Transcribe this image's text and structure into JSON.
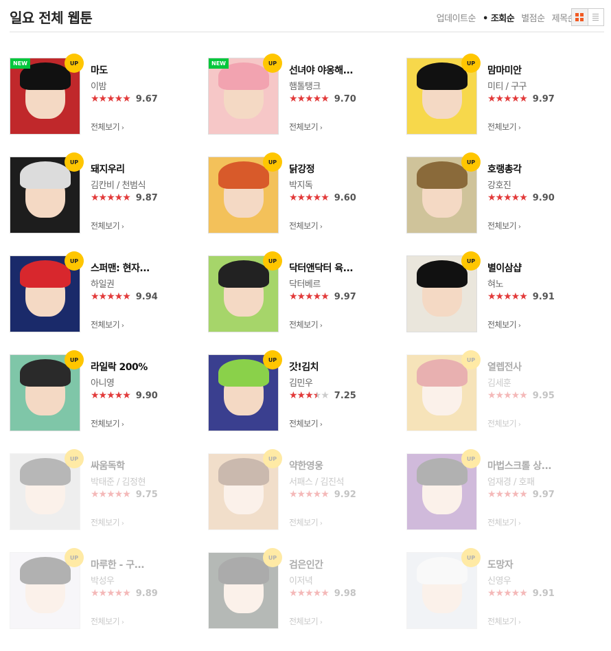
{
  "title": "일요 전체 웹툰",
  "sort_options": [
    "업데이트순",
    "조회순",
    "별점순",
    "제목순"
  ],
  "sort_active": "조회순",
  "view_icons": [
    "grid-view-icon",
    "list-view-icon"
  ],
  "more_label": "전체보기",
  "badge_up": "UP",
  "badge_new": "NEW",
  "items": [
    {
      "name": "마도",
      "author": "이밤",
      "score": "9.67",
      "stars": 5,
      "new": true,
      "dim": false,
      "bg": "#c0282b",
      "hair": "#111"
    },
    {
      "name": "선녀야 야옹해...",
      "author": "햄톨탱크",
      "score": "9.70",
      "stars": 5,
      "new": true,
      "dim": false,
      "bg": "#f6c7c7",
      "hair": "#f2a3b0"
    },
    {
      "name": "맘마미안",
      "author": "미티 / 구구",
      "score": "9.97",
      "stars": 5,
      "new": false,
      "dim": false,
      "bg": "#f7d84b",
      "hair": "#111"
    },
    {
      "name": "돼지우리",
      "author": "김칸비 / 천범식",
      "score": "9.87",
      "stars": 5,
      "new": false,
      "dim": false,
      "bg": "#1d1d1d",
      "hair": "#dcdcdc"
    },
    {
      "name": "닭강정",
      "author": "박지독",
      "score": "9.60",
      "stars": 5,
      "new": false,
      "dim": false,
      "bg": "#f3c15a",
      "hair": "#d85a2a"
    },
    {
      "name": "호랭총각",
      "author": "강호진",
      "score": "9.90",
      "stars": 5,
      "new": false,
      "dim": false,
      "bg": "#cfc39a",
      "hair": "#8a6a3a"
    },
    {
      "name": "스퍼맨: 현자...",
      "author": "하일권",
      "score": "9.94",
      "stars": 5,
      "new": false,
      "dim": false,
      "bg": "#1a2a6a",
      "hair": "#d8272d"
    },
    {
      "name": "닥터앤닥터 육...",
      "author": "닥터베르",
      "score": "9.97",
      "stars": 5,
      "new": false,
      "dim": false,
      "bg": "#a6d56a",
      "hair": "#222"
    },
    {
      "name": "별이삼샵",
      "author": "혀노",
      "score": "9.91",
      "stars": 5,
      "new": false,
      "dim": false,
      "bg": "#eae6dc",
      "hair": "#111"
    },
    {
      "name": "라일락 200%",
      "author": "아니영",
      "score": "9.90",
      "stars": 5,
      "new": false,
      "dim": false,
      "bg": "#7fc6a8",
      "hair": "#2a2a2a"
    },
    {
      "name": "갓!김치",
      "author": "김민우",
      "score": "7.25",
      "stars": 3.5,
      "new": false,
      "dim": false,
      "bg": "#3a3f8f",
      "hair": "#8ad14a"
    },
    {
      "name": "열렙전사",
      "author": "김세훈",
      "score": "9.95",
      "stars": 5,
      "new": false,
      "dim": true,
      "bg": "#e8b23a",
      "hair": "#c02020"
    },
    {
      "name": "싸움독학",
      "author": "박태준 / 김정현",
      "score": "9.75",
      "stars": 5,
      "new": false,
      "dim": true,
      "bg": "#cfcfcf",
      "hair": "#333"
    },
    {
      "name": "약한영웅",
      "author": "서패스 / 김진석",
      "score": "9.92",
      "stars": 5,
      "new": false,
      "dim": true,
      "bg": "#d9a36a",
      "hair": "#6a3a1a"
    },
    {
      "name": "마법스크롤 상...",
      "author": "엄재경 / 호패",
      "score": "9.97",
      "stars": 5,
      "new": false,
      "dim": true,
      "bg": "#7a3b9a",
      "hair": "#222"
    },
    {
      "name": "마루한 - 구...",
      "author": "박성우",
      "score": "9.89",
      "stars": 5,
      "new": false,
      "dim": true,
      "bg": "#e9e6ee",
      "hair": "#222"
    },
    {
      "name": "검은인간",
      "author": "이저녁",
      "score": "9.98",
      "stars": 5,
      "new": false,
      "dim": true,
      "bg": "#2e3a32",
      "hair": "#111"
    },
    {
      "name": "도망자",
      "author": "신영우",
      "score": "9.91",
      "stars": 5,
      "new": false,
      "dim": true,
      "bg": "#d8dde6",
      "hair": "#eeeeee"
    }
  ]
}
